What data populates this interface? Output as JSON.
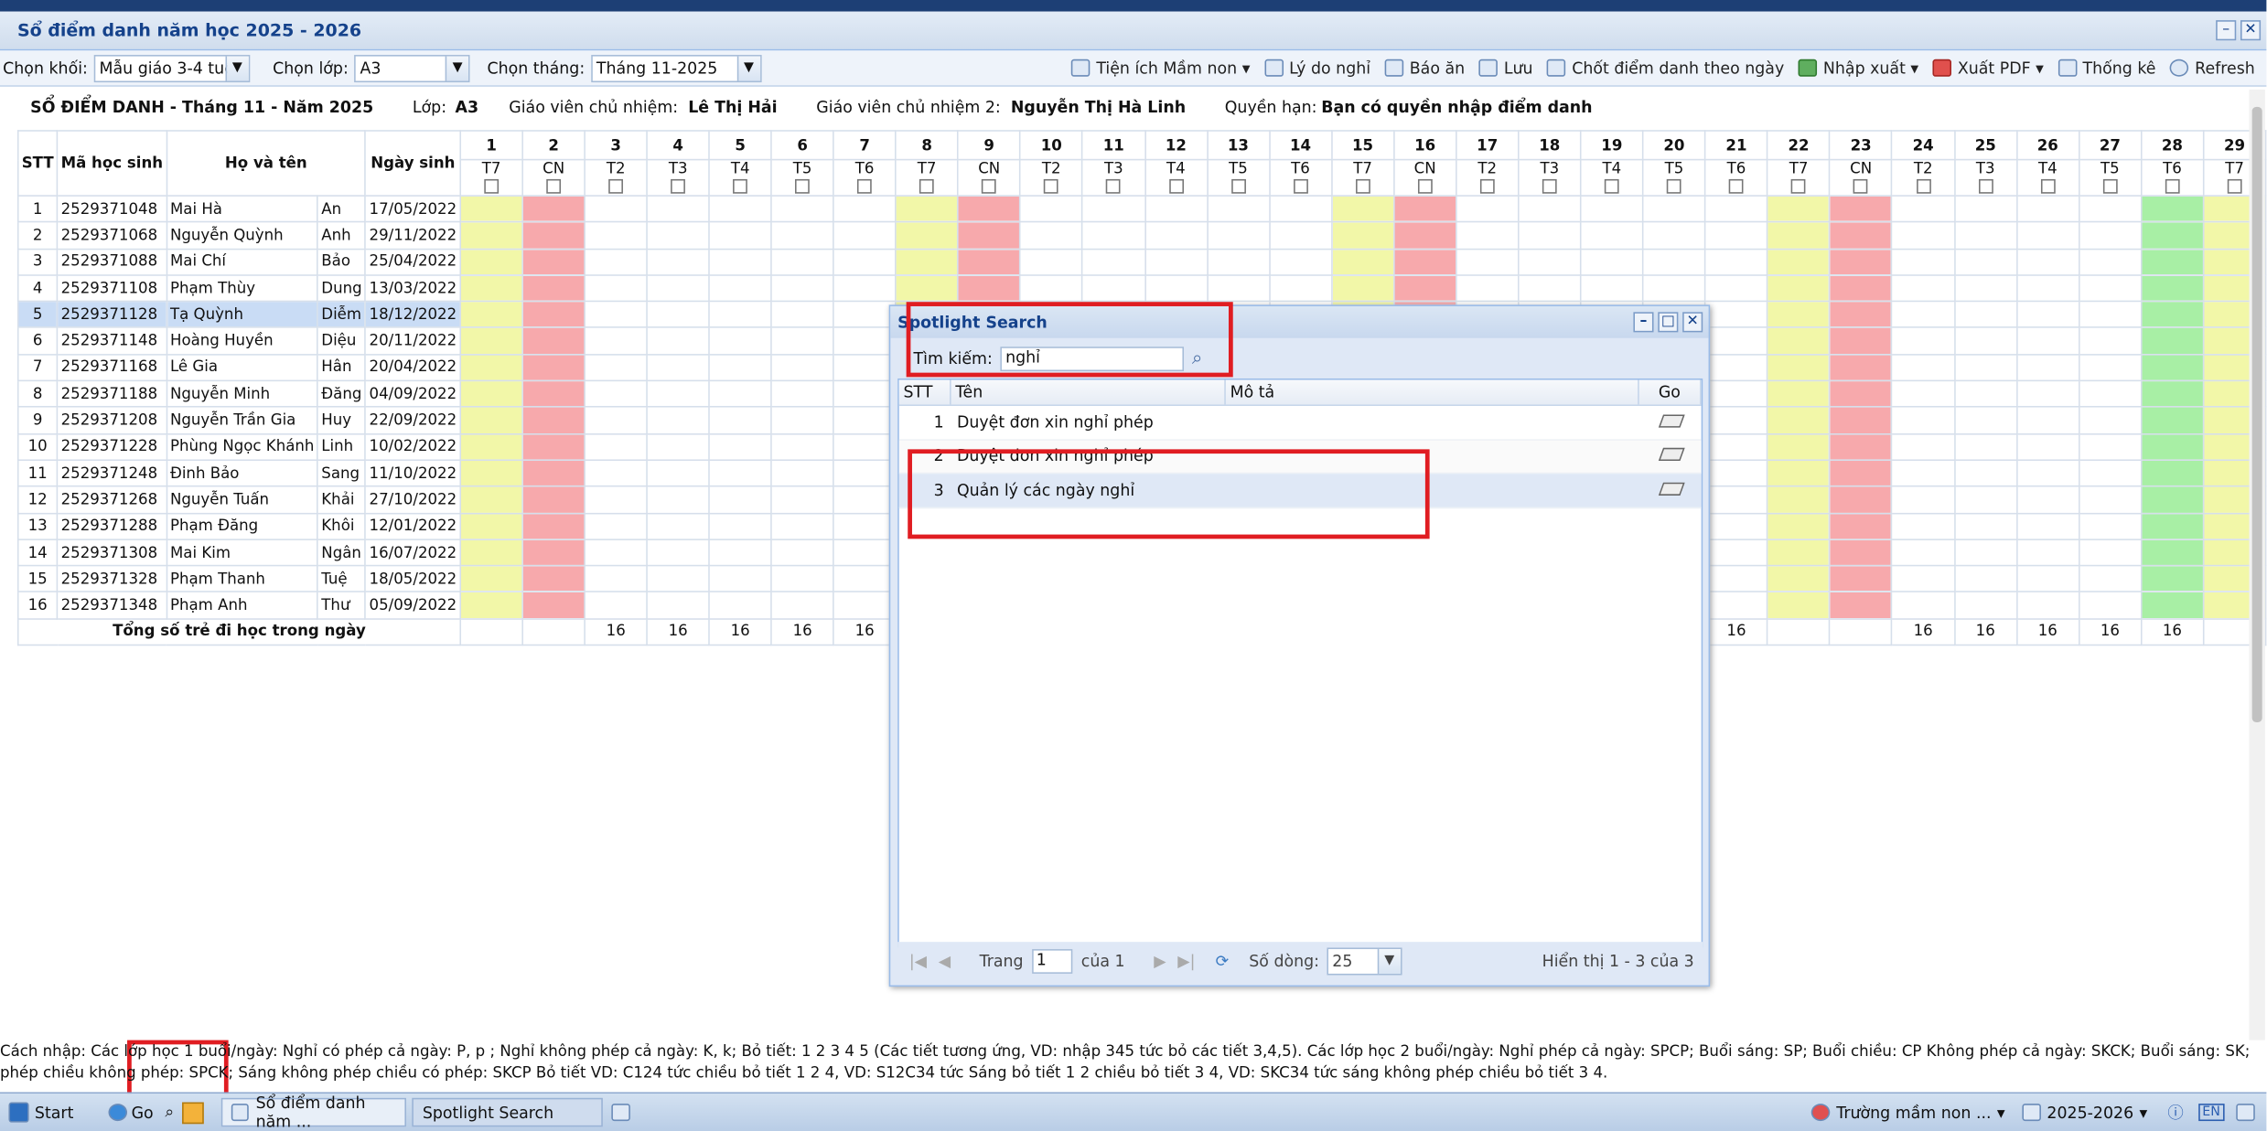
{
  "window": {
    "title": "Sổ điểm danh năm học 2025 - 2026"
  },
  "toolbar": {
    "khoi_label": "Chọn khối:",
    "khoi_value": "Mẫu giáo 3-4 tuổi",
    "lop_label": "Chọn lớp:",
    "lop_value": "A3",
    "thang_label": "Chọn tháng:",
    "thang_value": "Tháng 11-2025",
    "buttons": [
      "Tiện ích Mầm non ▾",
      "Lý do nghỉ",
      "Báo ăn",
      "Lưu",
      "Chốt điểm danh theo ngày",
      "Nhập xuất ▾",
      "Xuất PDF ▾",
      "Thống kê",
      "Refresh"
    ]
  },
  "info": {
    "title": "SỔ ĐIỂM DANH - Tháng 11 - Năm 2025",
    "lop_label": "Lớp:",
    "lop": "A3",
    "gv1_label": "Giáo viên chủ nhiệm:",
    "gv1": "Lê Thị Hải",
    "gv2_label": "Giáo viên chủ nhiệm 2:",
    "gv2": "Nguyễn Thị Hà Linh",
    "quyen_label": "Quyền hạn:",
    "quyen": "Bạn có quyền nhập điểm danh"
  },
  "grid": {
    "headers": {
      "stt": "STT",
      "ma": "Mã học sinh",
      "ten": "Họ và tên",
      "ns": "Ngày sinh"
    },
    "days": [
      "1",
      "2",
      "3",
      "4",
      "5",
      "6",
      "7",
      "8",
      "9",
      "10",
      "11",
      "12",
      "13",
      "14",
      "15",
      "16",
      "17",
      "18",
      "19",
      "20",
      "21",
      "22",
      "23",
      "24",
      "25",
      "26",
      "27",
      "28",
      "29"
    ],
    "weekdays": [
      "T7",
      "CN",
      "T2",
      "T3",
      "T4",
      "T5",
      "T6",
      "T7",
      "CN",
      "T2",
      "T3",
      "T4",
      "T5",
      "T6",
      "T7",
      "CN",
      "T2",
      "T3",
      "T4",
      "T5",
      "T6",
      "T7",
      "CN",
      "T2",
      "T3",
      "T4",
      "T5",
      "T6",
      "T7"
    ],
    "students": [
      [
        "1",
        "2529371048",
        "Mai Hà",
        "An",
        "17/05/2022"
      ],
      [
        "2",
        "2529371068",
        "Nguyễn Quỳnh",
        "Anh",
        "29/11/2022"
      ],
      [
        "3",
        "2529371088",
        "Mai Chí",
        "Bảo",
        "25/04/2022"
      ],
      [
        "4",
        "2529371108",
        "Phạm Thùy",
        "Dung",
        "13/03/2022"
      ],
      [
        "5",
        "2529371128",
        "Tạ Quỳnh",
        "Diễm",
        "18/12/2022"
      ],
      [
        "6",
        "2529371148",
        "Hoàng Huyền",
        "Diệu",
        "20/11/2022"
      ],
      [
        "7",
        "2529371168",
        "Lê Gia",
        "Hân",
        "20/04/2022"
      ],
      [
        "8",
        "2529371188",
        "Nguyễn Minh",
        "Đăng",
        "04/09/2022"
      ],
      [
        "9",
        "2529371208",
        "Nguyễn Trần Gia",
        "Huy",
        "22/09/2022"
      ],
      [
        "10",
        "2529371228",
        "Phùng Ngọc Khánh",
        "Linh",
        "10/02/2022"
      ],
      [
        "11",
        "2529371248",
        "Đinh Bảo",
        "Sang",
        "11/10/2022"
      ],
      [
        "12",
        "2529371268",
        "Nguyễn Tuấn",
        "Khải",
        "27/10/2022"
      ],
      [
        "13",
        "2529371288",
        "Phạm Đăng",
        "Khôi",
        "12/01/2022"
      ],
      [
        "14",
        "2529371308",
        "Mai Kim",
        "Ngân",
        "16/07/2022"
      ],
      [
        "15",
        "2529371328",
        "Phạm Thanh",
        "Tuệ",
        "18/05/2022"
      ],
      [
        "16",
        "2529371348",
        "Phạm Anh",
        "Thư",
        "05/09/2022"
      ]
    ],
    "total_label": "Tổng số trẻ đi học trong ngày",
    "totals": [
      "",
      "",
      "16",
      "16",
      "16",
      "16",
      "16",
      "",
      "",
      "",
      "",
      "",
      "",
      "",
      "",
      "",
      "",
      "",
      "",
      "",
      "16",
      "",
      "",
      "16",
      "16",
      "16",
      "16",
      "16",
      ""
    ]
  },
  "dialog": {
    "title": "Spotlight Search",
    "search_label": "Tìm kiếm:",
    "search_value": "nghỉ",
    "cols": {
      "stt": "STT",
      "ten": "Tên",
      "mota": "Mô tả",
      "go": "Go"
    },
    "rows": [
      {
        "n": "1",
        "name": "Duyệt đơn xin nghỉ phép"
      },
      {
        "n": "2",
        "name": "Duyệt đơn xin nghỉ phép"
      },
      {
        "n": "3",
        "name": "Quản lý các ngày nghỉ"
      }
    ],
    "pager": {
      "trang": "Trang",
      "page": "1",
      "of": "của 1",
      "rows_label": "Số dòng:",
      "rows": "25",
      "display": "Hiển thị 1 - 3 của 3"
    }
  },
  "legend": {
    "line1": "Cách nhập: Các lớp học 1 buổi/ngày: Nghỉ có phép cả ngày: P, p ;    Nghỉ không phép cả ngày: K, k;    Bỏ tiết: 1 2 3 4 5 (Các tiết tương ứng, VD: nhập 345 tức bỏ các tiết 3,4,5). Các lớp học 2 buổi/ngày: Nghỉ phép cả ngày: SPCP; Buổi sáng: SP;    Buổi chiều: CP    Không phép cả ngày: SKCK; Buổi sáng: SK;    Buổi chiều: CK.    Sáng có",
    "line2": "phép chiều không phép: SPCK; Sáng không phép chiều có phép: SKCP    Bỏ tiết VD: C124 tức chiều bỏ tiết 1 2 4, VD: S12C34 tức Sáng bỏ tiết 1 2 chiều bỏ tiết 3 4, VD: SKC34 tức sáng không phép chiều bỏ tiết 3 4."
  },
  "taskbar": {
    "start": "Start",
    "go": "Go",
    "task1": "Sổ điểm danh năm ...",
    "task2": "Spotlight Search",
    "school": "Trường mầm non ...",
    "year": "2025-2026",
    "lang": "EN"
  }
}
